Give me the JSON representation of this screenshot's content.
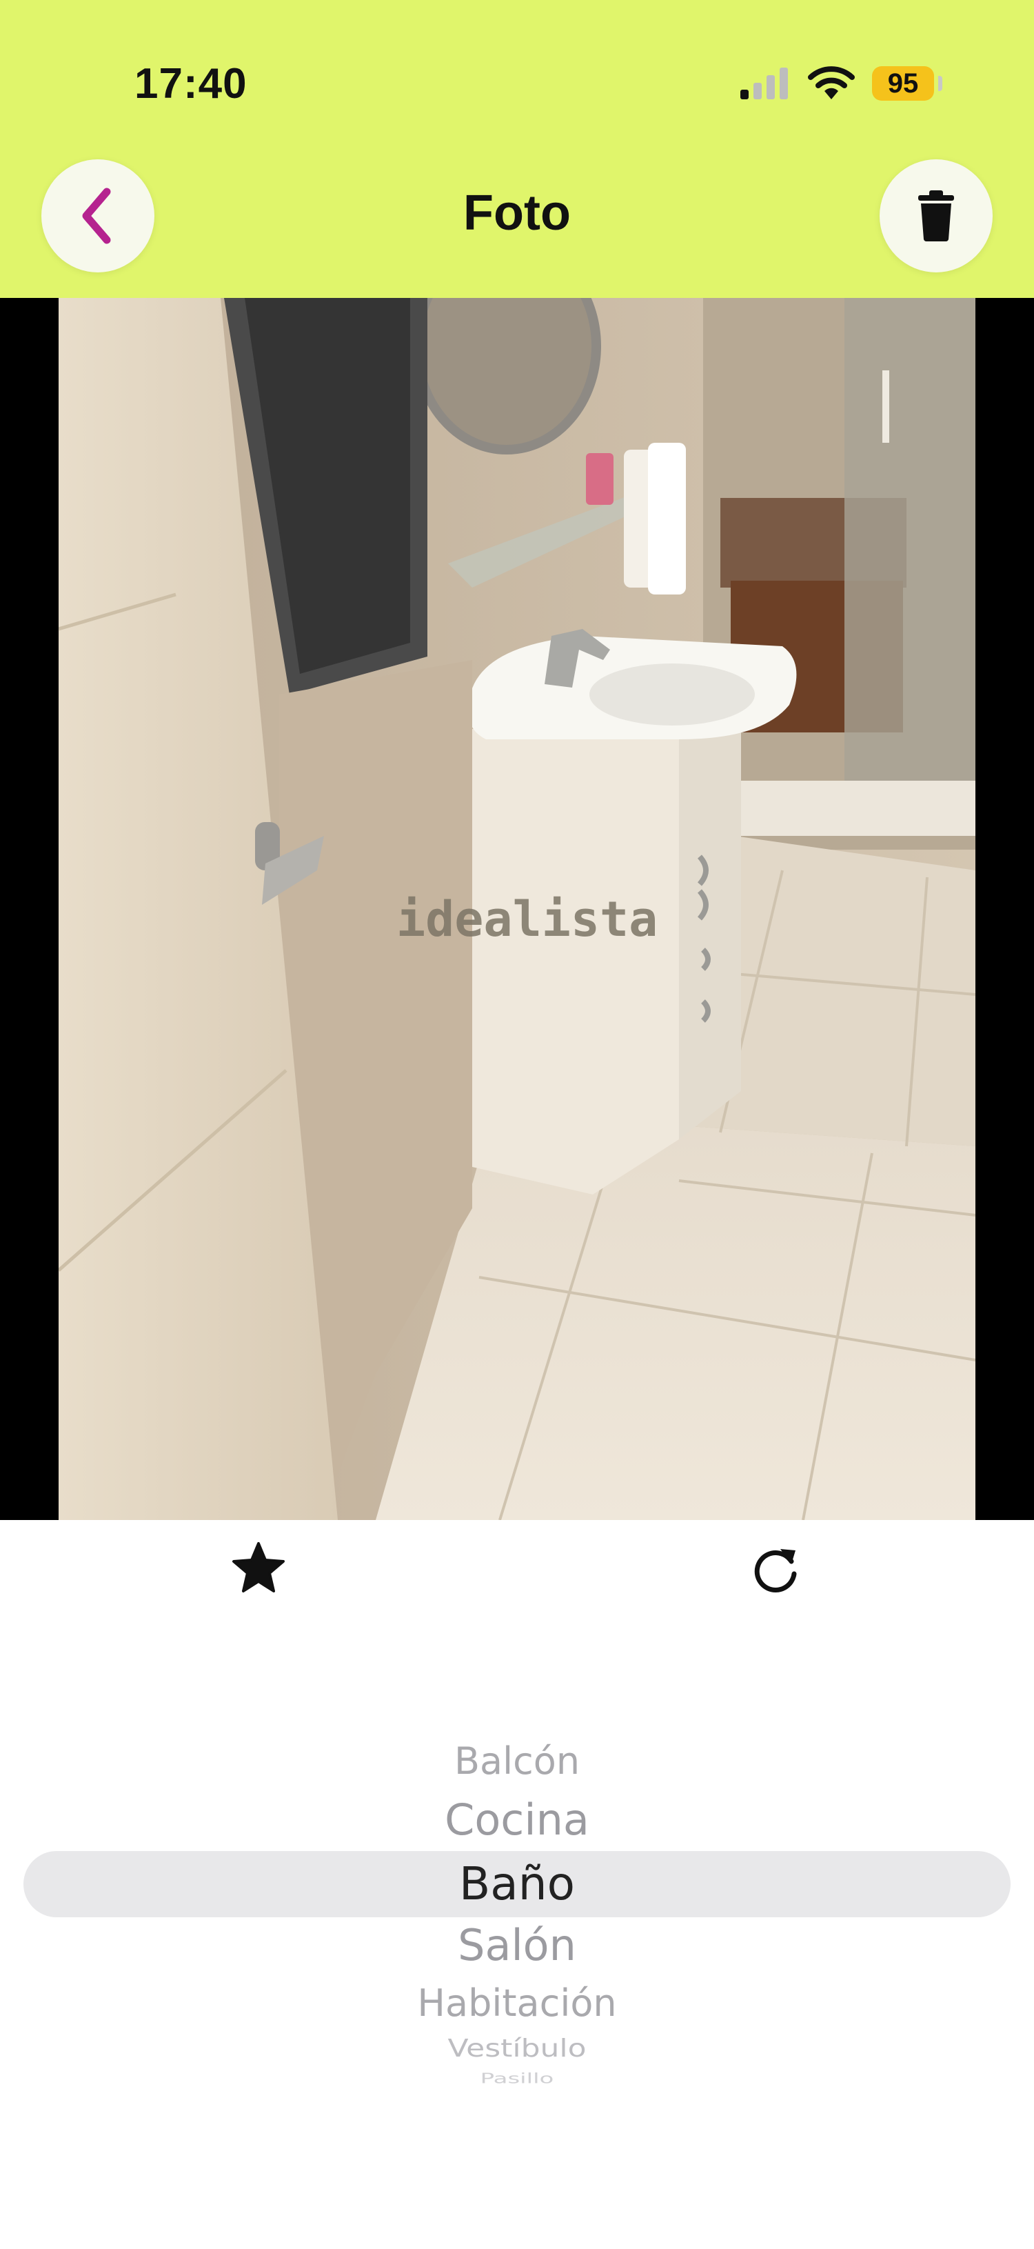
{
  "status_bar": {
    "time": "17:40",
    "battery_level": "95",
    "icons": [
      "cellular-signal-icon",
      "wifi-icon",
      "battery-icon"
    ]
  },
  "header": {
    "title": "Foto",
    "back_icon": "chevron-left-icon",
    "delete_icon": "trash-icon",
    "background_color": "#e0f56b",
    "accent_color": "#b5238f"
  },
  "photo": {
    "watermark": "idealista"
  },
  "actions": {
    "star_icon": "star-icon",
    "rotate_icon": "rotate-clockwise-icon"
  },
  "room_picker": {
    "options": [
      "Balcón",
      "Cocina",
      "Baño",
      "Salón",
      "Habitación",
      "Vestíbulo",
      "Pasillo"
    ],
    "selected": "Baño"
  }
}
